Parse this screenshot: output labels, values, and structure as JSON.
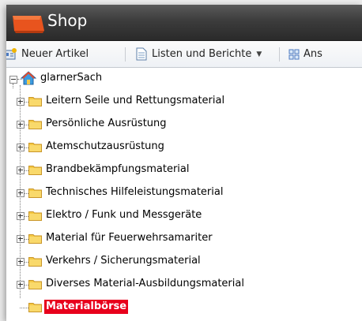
{
  "window": {
    "title": "Shop"
  },
  "toolbar": {
    "items": [
      {
        "label": "Neuer Artikel",
        "icon": "new-article-icon"
      },
      {
        "label": "Listen und Berichte",
        "icon": "document-icon",
        "has_dropdown": true
      },
      {
        "label": "Ans",
        "icon": "grid-icon"
      }
    ]
  },
  "tree": {
    "root": {
      "label": "glarnerSach",
      "icon": "home-icon",
      "expanded": true
    },
    "children": [
      {
        "label": "Leitern Seile und Rettungsmaterial",
        "expandable": true
      },
      {
        "label": "Persönliche Ausrüstung",
        "expandable": true
      },
      {
        "label": "Atemschutzausrüstung",
        "expandable": true
      },
      {
        "label": "Brandbekämpfungsmaterial",
        "expandable": true
      },
      {
        "label": "Technisches Hilfeleistungsmaterial",
        "expandable": true
      },
      {
        "label": "Elektro / Funk und Messgeräte",
        "expandable": true
      },
      {
        "label": "Material für Feuerwehrsamariter",
        "expandable": true
      },
      {
        "label": "Verkehrs / Sicherungsmaterial",
        "expandable": true
      },
      {
        "label": "Diverses Material-Ausbildungsmaterial",
        "expandable": true
      },
      {
        "label": "Materialbörse",
        "expandable": false,
        "selected": true
      }
    ]
  },
  "colors": {
    "titlebar": "#3c3c3c",
    "selection": "#e8001c",
    "folder": "#f5c842"
  }
}
